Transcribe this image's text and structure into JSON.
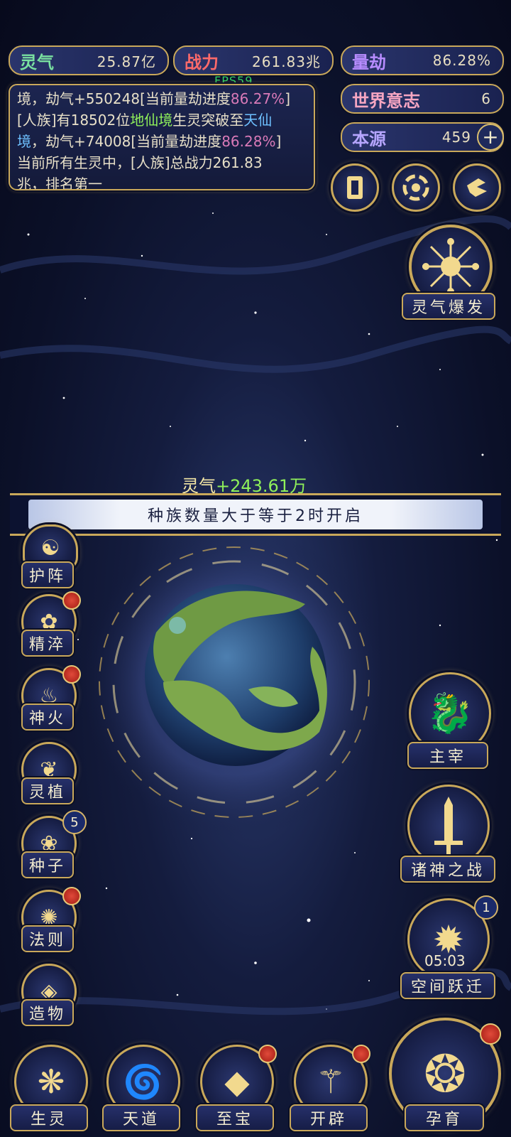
{
  "stats": {
    "lingqi": {
      "label": "灵气",
      "value": "25.87亿",
      "color": "#79e0a0"
    },
    "zhanli": {
      "label": "战力",
      "value": "261.83兆",
      "color": "#ff6a6a"
    },
    "liangjie": {
      "label": "量劫",
      "value": "86.28%",
      "color": "#b78cff"
    },
    "shijie": {
      "label": "世界意志",
      "value": "6",
      "color": "#f7a6c2"
    },
    "benyuan": {
      "label": "本源",
      "value": "459",
      "color": "#b6a6ff"
    }
  },
  "fps": "FPS59",
  "log": {
    "l1a": "境，劫气+550248[当前量劫进度",
    "l1b": "86.27%",
    "l1c": "]",
    "l2a": "[人族]有18502位",
    "l2b": "地仙境",
    "l2c": "生灵突破至",
    "l2d": "天仙",
    "l3a": "境",
    "l3b": "，劫气+74008[当前量劫进度",
    "l3c": "86.28%",
    "l3d": "]",
    "l4": "当前所有生灵中，[人族]总战力261.83",
    "l5": "兆，排名第一"
  },
  "burst_label": "灵气爆发",
  "gain": {
    "label": "灵气",
    "value": "+243.61万"
  },
  "banner": "种族数量大于等于2时开启",
  "left_menu": [
    {
      "label": "护阵"
    },
    {
      "label": "精淬"
    },
    {
      "label": "神火"
    },
    {
      "label": "灵植"
    },
    {
      "label": "种子",
      "badge": "5"
    },
    {
      "label": "法则"
    },
    {
      "label": "造物"
    }
  ],
  "right_menu": [
    {
      "label": "主宰"
    },
    {
      "label": "诸神之战"
    },
    {
      "label": "空间跃迁",
      "timer": "05:03",
      "badge": "1"
    }
  ],
  "bottom_menu": [
    {
      "label": "生灵"
    },
    {
      "label": "天道"
    },
    {
      "label": "至宝"
    },
    {
      "label": "开辟"
    }
  ],
  "big_button": "孕育"
}
